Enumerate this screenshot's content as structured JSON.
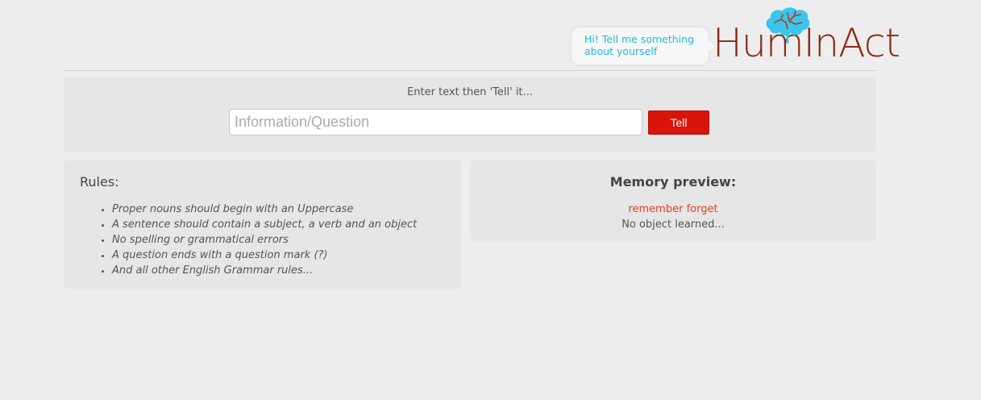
{
  "header": {
    "bubble_text": "Hi! Tell me something about yourself",
    "logo_text": "HumInAct",
    "logo_color": "#8b2a14",
    "brain_color": "#38c6ee"
  },
  "tell": {
    "prompt": "Enter text then 'Tell' it...",
    "input_value": "",
    "input_placeholder": "Information/Question",
    "button_label": "Tell",
    "button_color": "#d9140a"
  },
  "rules": {
    "title": "Rules:",
    "items": [
      "Proper nouns should begin with an Uppercase",
      "A sentence should contain a subject, a verb and an object",
      "No spelling or grammatical errors",
      "A question ends with a question mark (?)",
      "And all other English Grammar rules..."
    ]
  },
  "memory": {
    "title": "Memory preview:",
    "remember_label": "remember",
    "forget_label": "forget",
    "empty_text": "No object learned..."
  }
}
